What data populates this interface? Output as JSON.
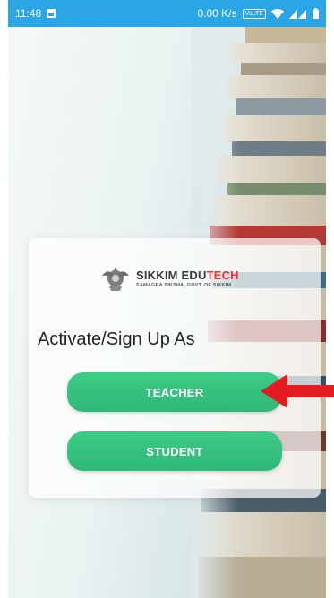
{
  "status_bar": {
    "time": "11:48",
    "network_speed": "0.00 K/s",
    "volte_label": "VoLTE",
    "bg_color": "#2aa6e6"
  },
  "logo": {
    "title_main": "SIKKIM EDU",
    "title_accent": "TECH",
    "subtitle": "SAMAGRA SIKSHA, GOVT. OF SIKKIM",
    "accent_color": "#e53935"
  },
  "card": {
    "heading": "Activate/Sign Up As",
    "teacher_label": "TEACHER",
    "student_label": "STUDENT",
    "button_color": "#35c27e"
  },
  "annotation": {
    "arrow_color": "#e31b23",
    "arrow_icon": "red-arrow-icon"
  }
}
